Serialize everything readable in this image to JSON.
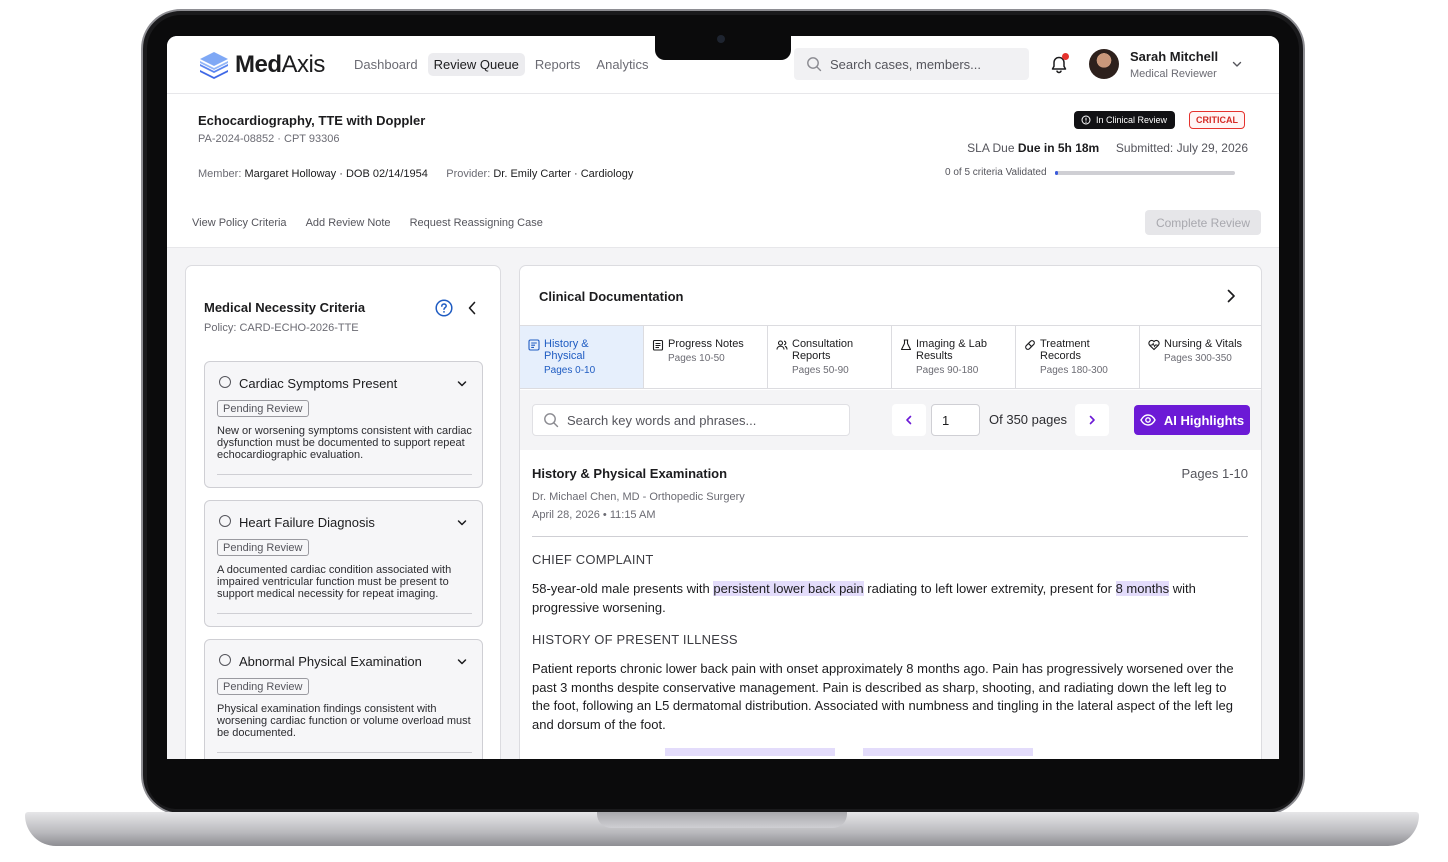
{
  "brand": {
    "name_bold": "Med",
    "name_rest": "Axis"
  },
  "nav": {
    "items": [
      {
        "label": "Dashboard",
        "active": false
      },
      {
        "label": "Review Queue",
        "active": true
      },
      {
        "label": "Reports",
        "active": false
      },
      {
        "label": "Analytics",
        "active": false
      }
    ],
    "search_placeholder": "Search cases, members..."
  },
  "user": {
    "name": "Sarah Mitchell",
    "role": "Medical Reviewer"
  },
  "case": {
    "title": "Echocardiography, TTE with Doppler",
    "id_line": "PA-2024-08852 · CPT 93306",
    "member_label": "Member:",
    "member_value": "Margaret Holloway · DOB 02/14/1954",
    "provider_label": "Provider:",
    "provider_value": "Dr. Emily Carter · Cardiology",
    "status_badge": "In Clinical Review",
    "priority_badge": "CRITICAL",
    "sla_label": "SLA Due",
    "sla_value": "Due in 5h 18m",
    "submitted_label": "Submitted:",
    "submitted_value": "July 29, 2026",
    "criteria_progress_text": "0 of 5 criteria Validated",
    "criteria_progress_fraction": 0.02,
    "actions": [
      "View Policy Criteria",
      "Add Review Note",
      "Request Reassigning Case"
    ],
    "complete_label": "Complete Review"
  },
  "criteria_panel": {
    "title": "Medical Necessity Criteria",
    "policy": "Policy: CARD-ECHO-2026-TTE",
    "items": [
      {
        "title": "Cardiac Symptoms Present",
        "status": "Pending Review",
        "description": "New or worsening symptoms consistent with cardiac dysfunction must be documented to support repeat echocardiographic evaluation."
      },
      {
        "title": "Heart Failure Diagnosis",
        "status": "Pending Review",
        "description": "A documented cardiac condition associated with impaired ventricular function must be present to support medical necessity for repeat imaging."
      },
      {
        "title": "Abnormal Physical Examination",
        "status": "Pending Review",
        "description": "Physical examination findings consistent with worsening cardiac function or volume overload must be documented."
      }
    ]
  },
  "documentation": {
    "title": "Clinical Documentation",
    "tabs": [
      {
        "label": "History & Physical",
        "pages": "Pages 0-10",
        "icon": "history-icon",
        "active": true
      },
      {
        "label": "Progress Notes",
        "pages": "Pages 10-50",
        "icon": "notes-icon",
        "active": false
      },
      {
        "label": "Consultation Reports",
        "pages": "Pages 50-90",
        "icon": "users-icon",
        "active": false
      },
      {
        "label": "Imaging & Lab Results",
        "pages": "Pages 90-180",
        "icon": "flask-icon",
        "active": false
      },
      {
        "label": "Treatment Records",
        "pages": "Pages 180-300",
        "icon": "pill-icon",
        "active": false
      },
      {
        "label": "Nursing & Vitals",
        "pages": "Pages 300-350",
        "icon": "heart-pulse-icon",
        "active": false
      }
    ],
    "search_placeholder": "Search key words and phrases...",
    "page_value": "1",
    "page_total_text": "Of 350 pages",
    "ai_label": "AI Highlights",
    "doc": {
      "title": "History & Physical Examination",
      "pages": "Pages 1-10",
      "author": "Dr. Michael Chen, MD - Orthopedic Surgery",
      "date": "April 28, 2026 • 11:15 AM",
      "section1": "CHIEF COMPLAINT",
      "p1_a": "58-year-old male presents with ",
      "p1_hl1": "persistent lower back pain",
      "p1_b": " radiating to left lower extremity, present for ",
      "p1_hl2": "8 months",
      "p1_c": " with progressive worsening.",
      "section2": "HISTORY OF PRESENT ILLNESS",
      "p2": "Patient reports chronic lower back pain with onset approximately 8 months ago. Pain has progressively worsened over the past 3 months despite conservative management. Pain is described as sharp, shooting, and radiating down the left leg to the foot, following an L5 dermatomal distribution. Associated with numbness and tingling in the lateral aspect of the left leg and dorsum of the foot."
    }
  }
}
